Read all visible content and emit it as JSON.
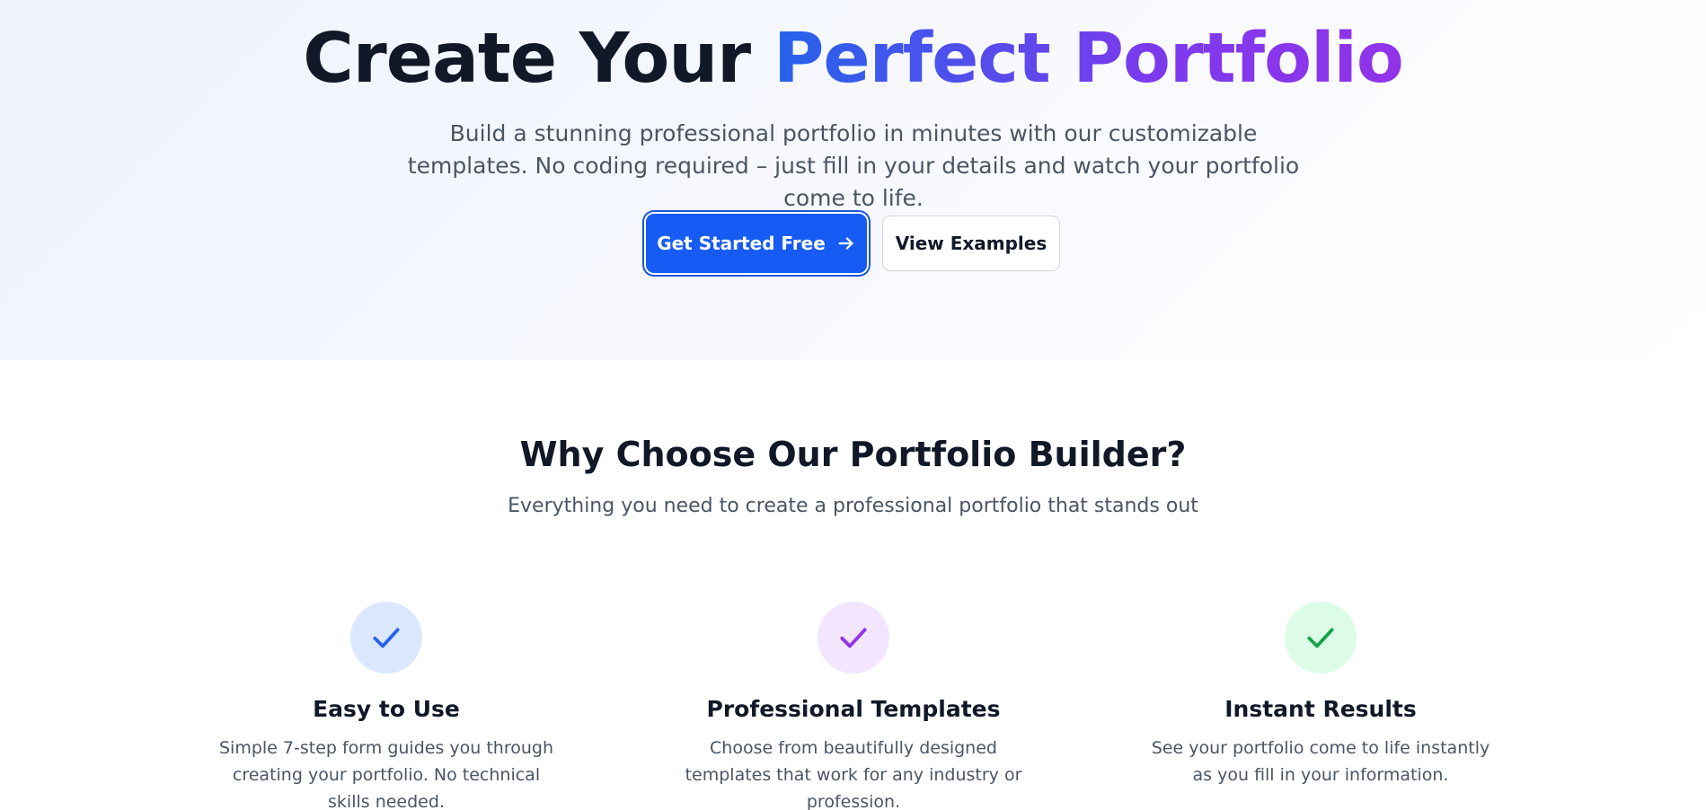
{
  "hero": {
    "title_plain": "Create Your ",
    "title_highlight": "Perfect Portfolio",
    "subtitle": "Build a stunning professional portfolio in minutes with our customizable templates. No coding required – just fill in your details and watch your portfolio come to life.",
    "primary_button": "Get Started Free",
    "primary_button_icon": "arrow-right-icon",
    "secondary_button": "View Examples"
  },
  "features": {
    "title": "Why Choose Our Portfolio Builder?",
    "subtitle": "Everything you need to create a professional portfolio that stands out",
    "items": [
      {
        "title": "Easy to Use",
        "description": "Simple 7-step form guides you through creating your portfolio. No technical skills needed.",
        "icon": "check-icon",
        "icon_color": "#2563eb",
        "icon_bg": "#dbe7fd"
      },
      {
        "title": "Professional Templates",
        "description": "Choose from beautifully designed templates that work for any industry or profession.",
        "icon": "check-icon",
        "icon_color": "#9333ea",
        "icon_bg": "#f3e5fd"
      },
      {
        "title": "Instant Results",
        "description": "See your portfolio come to life instantly as you fill in your information.",
        "icon": "check-icon",
        "icon_color": "#16a34a",
        "icon_bg": "#dcfce7"
      }
    ]
  },
  "colors": {
    "primary": "#165cf4",
    "heading": "#111827",
    "body_text": "#4b5563",
    "gradient_start": "#2563eb",
    "gradient_end": "#9333ea"
  }
}
